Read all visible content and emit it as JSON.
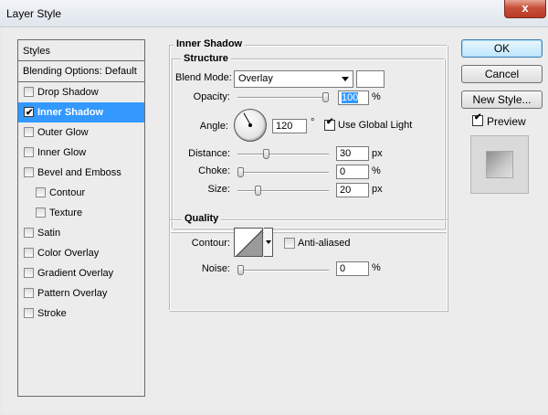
{
  "window": {
    "title": "Layer Style",
    "close_glyph": "x"
  },
  "styles_panel": {
    "header": "Styles",
    "blending_options": "Blending Options: Default",
    "items": [
      {
        "label": "Drop Shadow",
        "checked": false,
        "selected": false,
        "sub": false
      },
      {
        "label": "Inner Shadow",
        "checked": true,
        "selected": true,
        "sub": false
      },
      {
        "label": "Outer Glow",
        "checked": false,
        "selected": false,
        "sub": false
      },
      {
        "label": "Inner Glow",
        "checked": false,
        "selected": false,
        "sub": false
      },
      {
        "label": "Bevel and Emboss",
        "checked": false,
        "selected": false,
        "sub": false
      },
      {
        "label": "Contour",
        "checked": false,
        "selected": false,
        "sub": true
      },
      {
        "label": "Texture",
        "checked": false,
        "selected": false,
        "sub": true
      },
      {
        "label": "Satin",
        "checked": false,
        "selected": false,
        "sub": false
      },
      {
        "label": "Color Overlay",
        "checked": false,
        "selected": false,
        "sub": false
      },
      {
        "label": "Gradient Overlay",
        "checked": false,
        "selected": false,
        "sub": false
      },
      {
        "label": "Pattern Overlay",
        "checked": false,
        "selected": false,
        "sub": false
      },
      {
        "label": "Stroke",
        "checked": false,
        "selected": false,
        "sub": false
      }
    ]
  },
  "inner_shadow": {
    "title": "Inner Shadow",
    "structure": {
      "title": "Structure",
      "blend_mode_label": "Blend Mode:",
      "blend_mode_value": "Overlay",
      "shadow_color": "#ffffff",
      "opacity_label": "Opacity:",
      "opacity_value": "100",
      "opacity_unit": "%",
      "opacity_level": 100,
      "angle_label": "Angle:",
      "angle_value": "120",
      "angle_unit": "°",
      "use_global_light_label": "Use Global Light",
      "use_global_light": true,
      "distance_label": "Distance:",
      "distance_value": "30",
      "distance_unit": "px",
      "distance_level": 30,
      "choke_label": "Choke:",
      "choke_value": "0",
      "choke_unit": "%",
      "choke_level": 0,
      "size_label": "Size:",
      "size_value": "20",
      "size_unit": "px",
      "size_level": 20
    },
    "quality": {
      "title": "Quality",
      "contour_label": "Contour:",
      "anti_aliased_label": "Anti-aliased",
      "anti_aliased": false,
      "noise_label": "Noise:",
      "noise_value": "0",
      "noise_unit": "%",
      "noise_level": 0
    }
  },
  "buttons": {
    "ok": "OK",
    "cancel": "Cancel",
    "new_style": "New Style...",
    "preview_label": "Preview",
    "preview_checked": true
  }
}
